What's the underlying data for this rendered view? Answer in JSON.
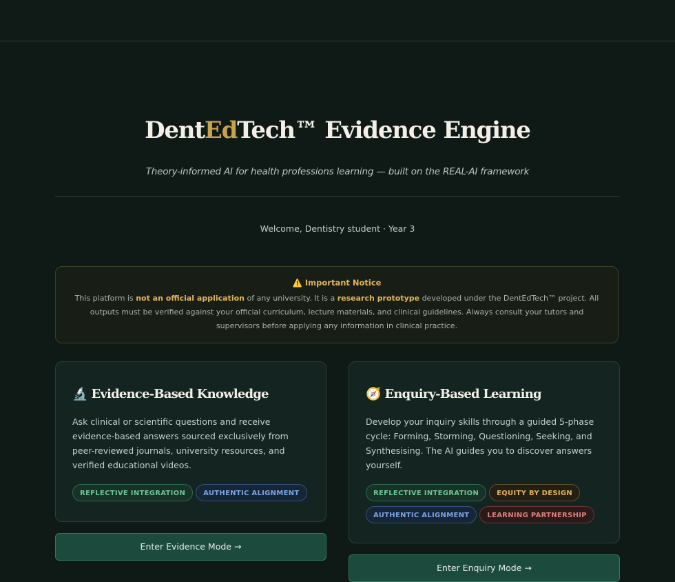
{
  "hero": {
    "title_part1": "Dent",
    "title_part2": "Ed",
    "title_part3": "Tech™ Evidence Engine",
    "subtitle": "Theory-informed AI for health professions learning — built on the REAL-AI framework",
    "welcome": "Welcome, Dentistry student · Year 3"
  },
  "notice": {
    "icon": "⚠️",
    "title": "Important Notice",
    "body_1": "This platform is ",
    "body_bold_1": "not an official application",
    "body_2": " of any university. It is a ",
    "body_bold_2": "research prototype",
    "body_3": " developed under the DentEdTech™ project. All outputs must be verified against your official curriculum, lecture materials, and clinical guidelines. Always consult your tutors and supervisors before applying any information in clinical practice."
  },
  "cards": {
    "evidence": {
      "icon": "🔬",
      "title": "Evidence-Based Knowledge",
      "description": "Ask clinical or scientific questions and receive evidence-based answers sourced exclusively from peer-reviewed journals, university resources, and verified educational videos.",
      "tags": [
        "REFLECTIVE INTEGRATION",
        "AUTHENTIC ALIGNMENT"
      ],
      "button": "Enter Evidence Mode →"
    },
    "enquiry": {
      "icon": "🧭",
      "title": "Enquiry-Based Learning",
      "description": "Develop your inquiry skills through a guided 5-phase cycle: Forming, Storming, Questioning, Seeking, and Synthesising. The AI guides you to discover answers yourself.",
      "tags": [
        "REFLECTIVE INTEGRATION",
        "EQUITY BY DESIGN",
        "AUTHENTIC ALIGNMENT",
        "LEARNING PARTNERSHIP"
      ],
      "button": "Enter Enquiry Mode →"
    }
  },
  "colors": {
    "background": "#0f1a17",
    "accent_gold": "#c9a24a",
    "button_green": "#1c4a3d"
  }
}
